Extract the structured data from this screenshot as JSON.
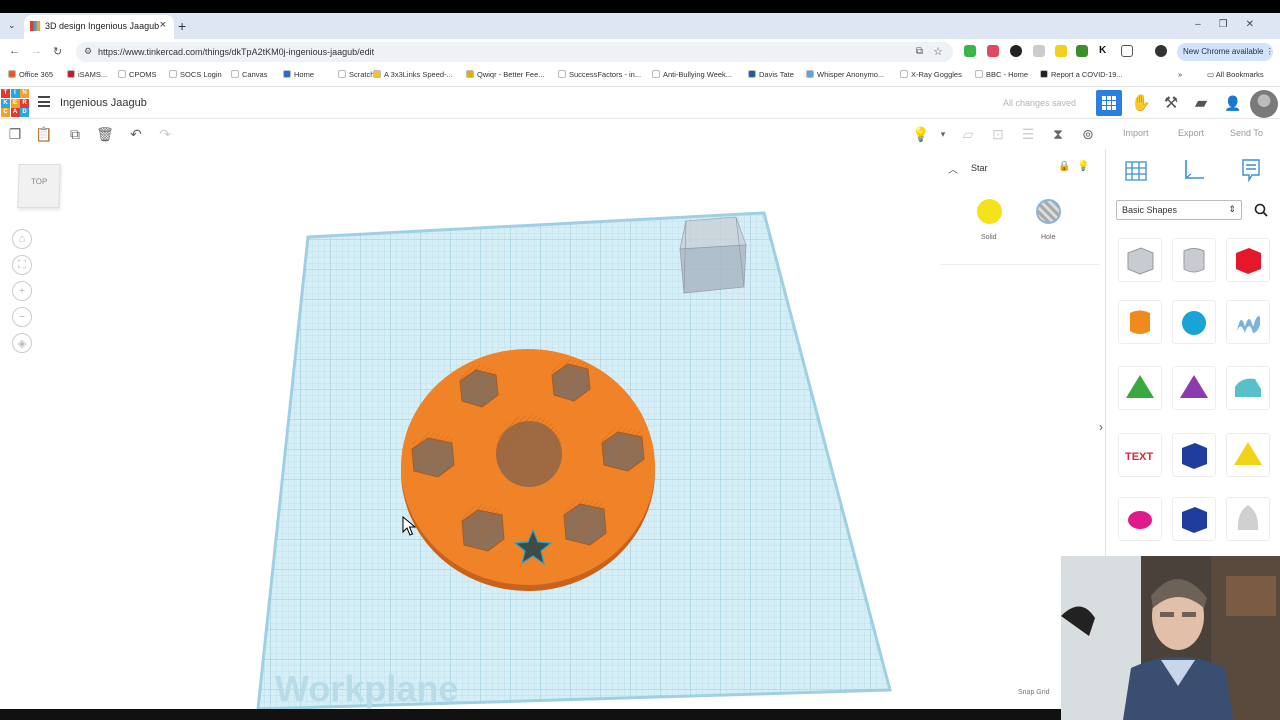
{
  "browser": {
    "tab_title": "3D design Ingenious Jaagub",
    "tab_close": "×",
    "new_tab": "+",
    "tab_menu": "⌄",
    "url": "https://www.tinkercad.com/things/dkTpA2tKM0j-ingenious-jaagub/edit",
    "new_chrome_label": "New Chrome available",
    "bookmarks": [
      {
        "label": "Office 365",
        "color": "#e85a24"
      },
      {
        "label": "iSAMS...",
        "color": "#c21b2c"
      },
      {
        "label": "CPOMS",
        "color": "#ffffff"
      },
      {
        "label": "SOCS Login",
        "color": "#ffffff"
      },
      {
        "label": "Canvas",
        "color": "#ffffff"
      },
      {
        "label": "Home",
        "color": "#2a6ad6"
      },
      {
        "label": "Scratch",
        "color": "#ffffff"
      },
      {
        "label": "A 3x3Links Speed-...",
        "color": "#f3c12b"
      },
      {
        "label": "Qwiqr - Better Fee...",
        "color": "#d8b400"
      },
      {
        "label": "SuccessFactors - in...",
        "color": "#ffffff"
      },
      {
        "label": "Anti-Bullying Week...",
        "color": "#ffffff"
      },
      {
        "label": "Davis Tate",
        "color": "#2a58a6"
      },
      {
        "label": "Whisper Anonymo...",
        "color": "#5aa2e0"
      },
      {
        "label": "X-Ray Goggles",
        "color": "#ffffff"
      },
      {
        "label": "BBC - Home",
        "color": "#ffffff"
      },
      {
        "label": "Report a COVID-19...",
        "color": "#222222"
      }
    ],
    "bookmarks_more": "»",
    "all_bookmarks": "All Bookmarks"
  },
  "app": {
    "logo_letters": [
      "T",
      "I",
      "N",
      "K",
      "E",
      "R",
      "C",
      "A",
      "D"
    ],
    "project_title": "Ingenious Jaagub",
    "save_status": "All changes saved",
    "toolbar_links": {
      "import": "Import",
      "export": "Export",
      "send_to": "Send To"
    }
  },
  "canvas": {
    "viewcube_label": "TOP",
    "workplane_label": "Workplane",
    "snap_grid_label": "Snap Grid"
  },
  "inspector": {
    "title": "Star",
    "solid_label": "Solid",
    "hole_label": "Hole",
    "solid_color": "#f5e21a"
  },
  "shapes_panel": {
    "category": "Basic Shapes",
    "shapes": [
      {
        "name": "box-hole",
        "color": "#c8ccd2"
      },
      {
        "name": "cylinder-hole",
        "color": "#c8ccd2"
      },
      {
        "name": "box",
        "color": "#e4172b"
      },
      {
        "name": "cylinder",
        "color": "#f08a1c"
      },
      {
        "name": "sphere",
        "color": "#1aa4d6"
      },
      {
        "name": "scribble",
        "color": "#7bb3e0"
      },
      {
        "name": "roof",
        "color": "#3aa83e"
      },
      {
        "name": "cone",
        "color": "#8a3bb0"
      },
      {
        "name": "round-roof",
        "color": "#58c0c8"
      },
      {
        "name": "text",
        "color": "#d8283a"
      },
      {
        "name": "wedge",
        "color": "#1f3d9c"
      },
      {
        "name": "pyramid",
        "color": "#f2d318"
      },
      {
        "name": "half-sphere",
        "color": "#e01a8a"
      },
      {
        "name": "polygon",
        "color": "#1f3d9c"
      },
      {
        "name": "paraboloid",
        "color": "#d0d0d0"
      }
    ]
  },
  "colors": {
    "accent": "#2a7fe0",
    "disc": "#f08228",
    "workplane": "#cfe9f2"
  }
}
